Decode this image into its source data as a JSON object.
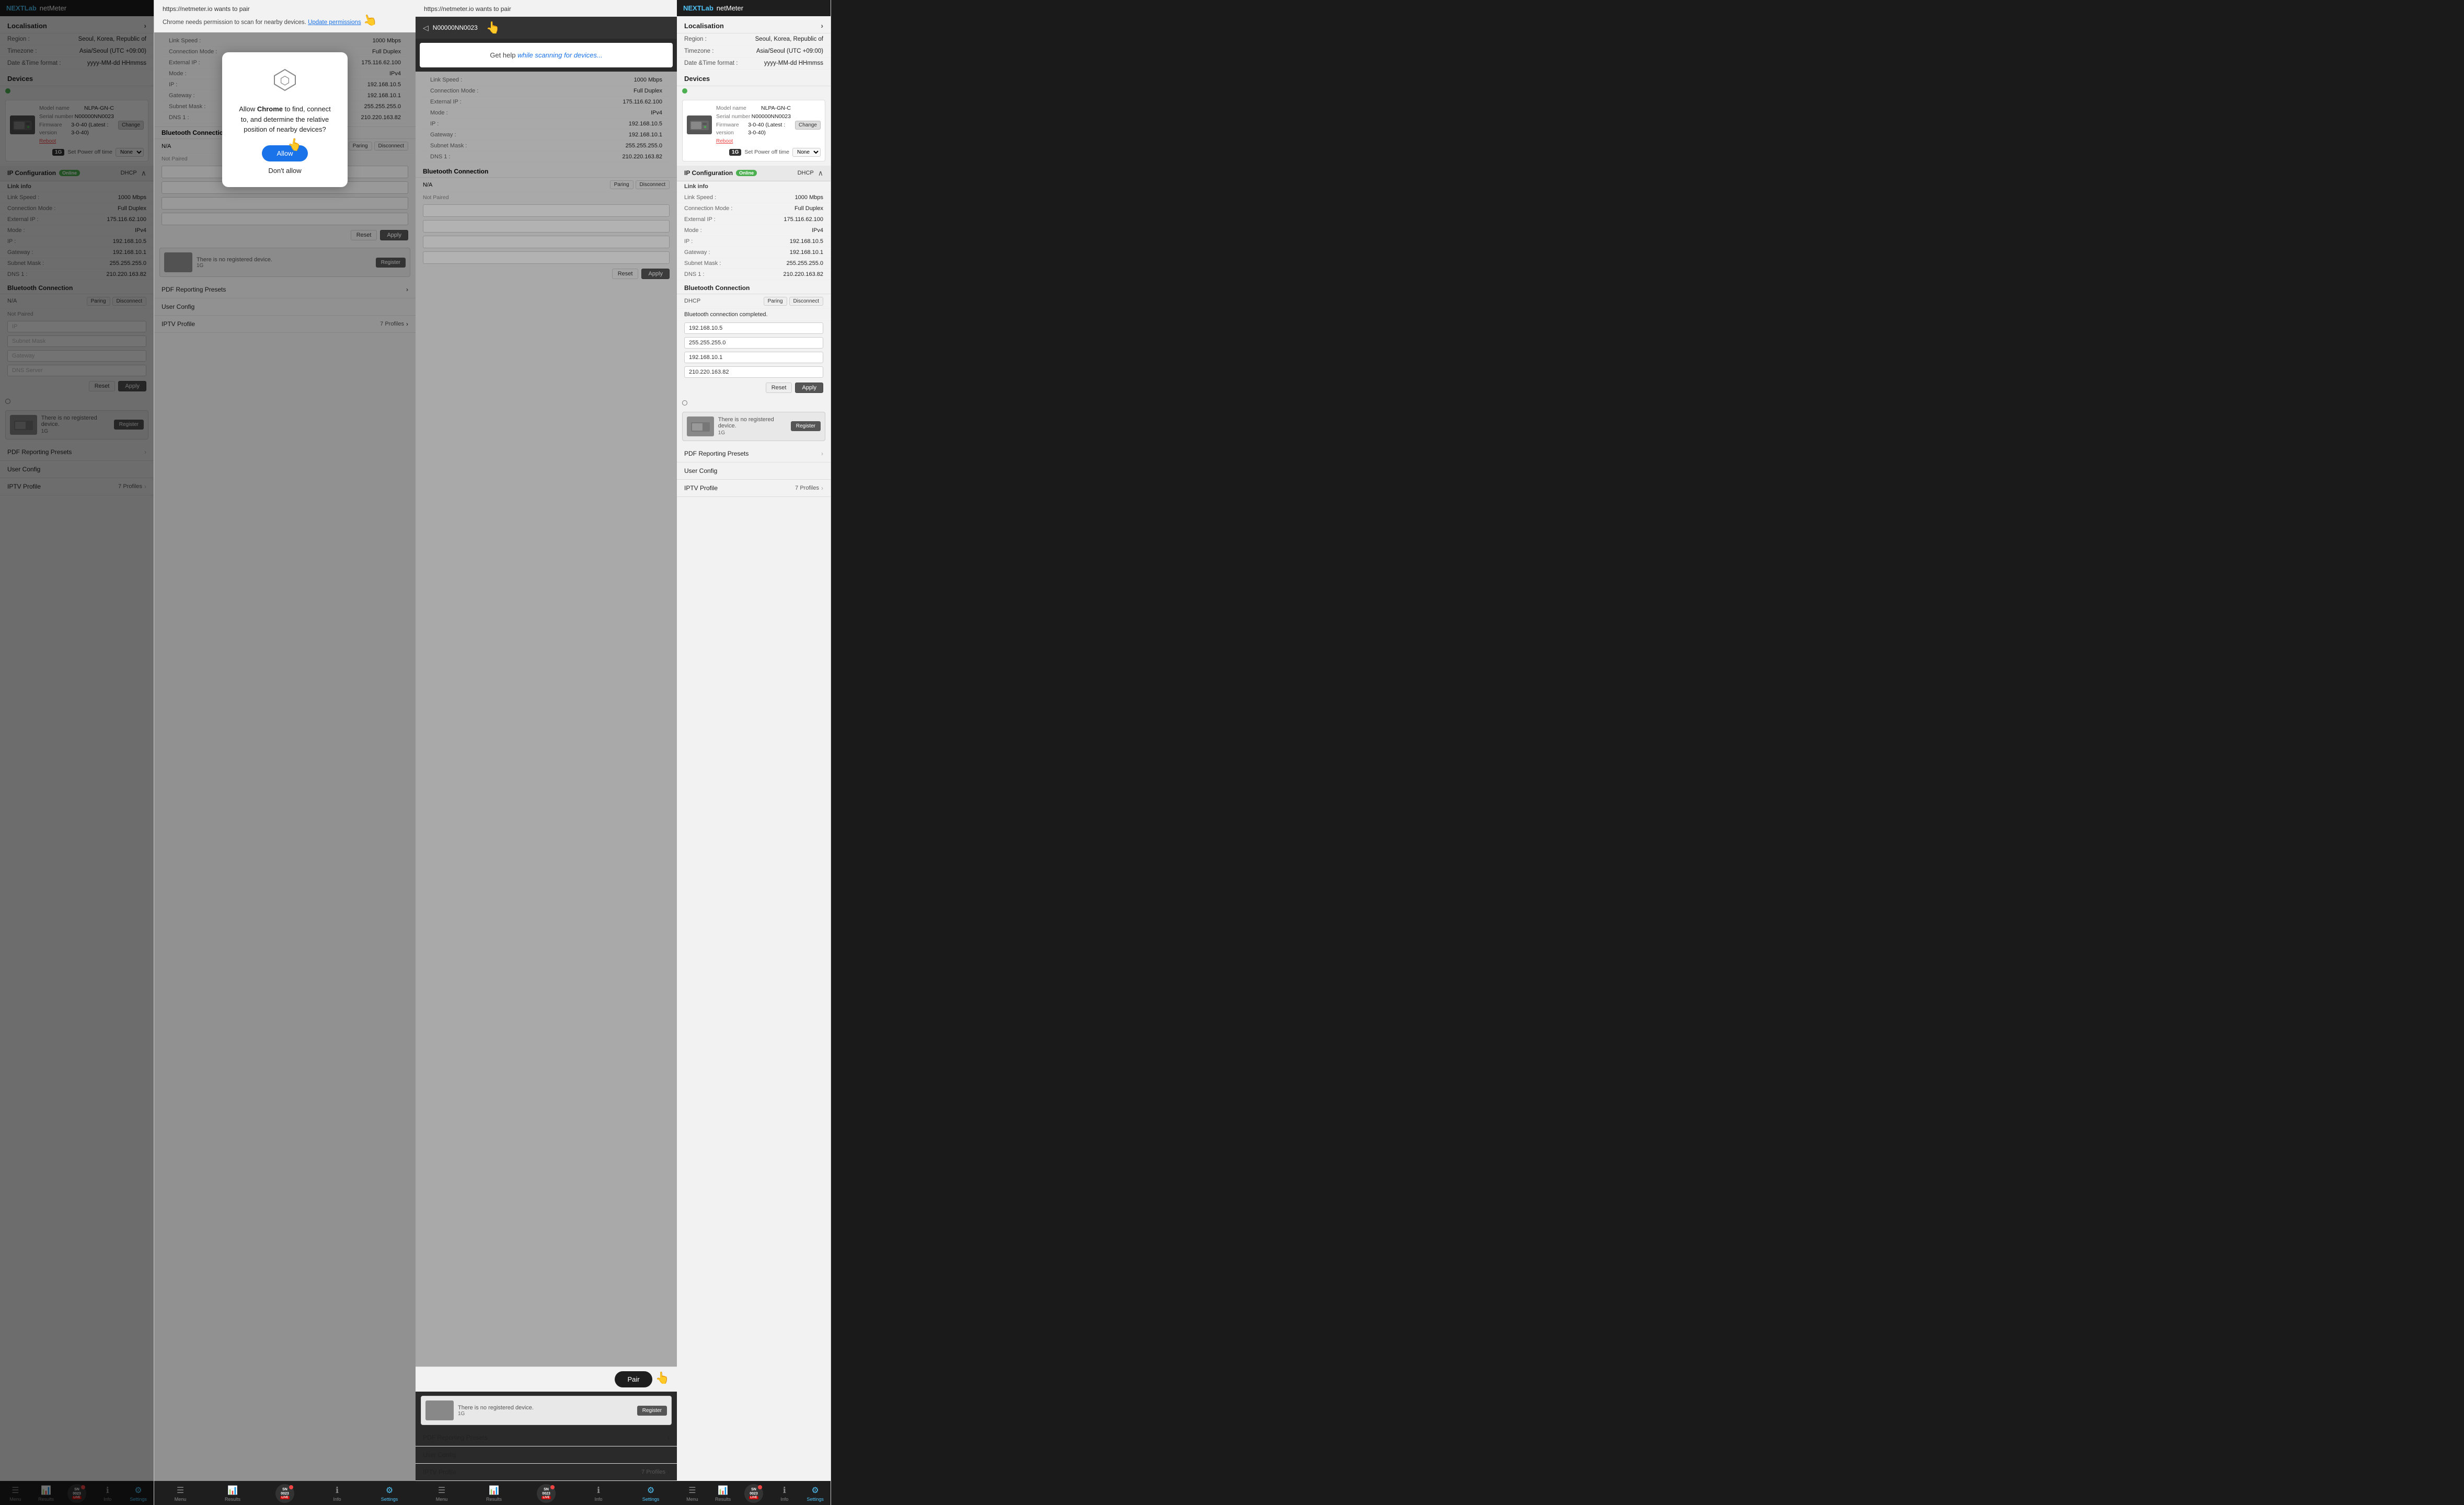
{
  "app": {
    "brand": "NEXTLab",
    "name": "netMeter"
  },
  "localisation": {
    "section_title": "Localisation",
    "region_label": "Region :",
    "region_value": "Seoul, Korea, Republic of",
    "timezone_label": "Timezone :",
    "timezone_value": "Asia/Seoul (UTC +09:00)",
    "datetime_label": "Date &Time format :",
    "datetime_value": "yyyy-MM-dd HHmmss"
  },
  "devices": {
    "section_title": "Devices",
    "device1": {
      "model_label": "Model name",
      "model_value": "NLPA-GN-C",
      "serial_label": "Serial number",
      "serial_value": "N00000NN0023",
      "firmware_label": "Firmware version",
      "firmware_value": "3-0-40 (Latest : 3-0-40)",
      "reboot_label": "Reboot",
      "power_off_label": "Set Power off time",
      "power_off_value": "None",
      "speed": "1G",
      "change_btn": "Change"
    },
    "device2": {
      "no_device_text": "There is no registered device.",
      "speed": "1G",
      "register_btn": "Register"
    }
  },
  "ip_config": {
    "section_title": "IP Configuration",
    "status_badge": "Online",
    "mode_label": "DHCP",
    "link_info_title": "Link info",
    "link_speed_label": "Link Speed :",
    "link_speed_value": "1000 Mbps",
    "conn_mode_label": "Connection Mode :",
    "conn_mode_value": "Full Duplex",
    "ext_ip_label": "External IP :",
    "ext_ip_value": "175.116.62.100",
    "mode_label2": "Mode :",
    "mode_value": "IPv4",
    "ip_label": "IP :",
    "ip_value": "192.168.10.5",
    "gateway_label": "Gateway :",
    "gateway_value": "192.168.10.1",
    "subnet_label": "Subnet Mask :",
    "subnet_value": "255.255.255.0",
    "dns_label": "DNS 1 :",
    "dns_value": "210.220.163.82"
  },
  "bluetooth": {
    "section_title": "Bluetooth Connection",
    "status": "N/A",
    "pair_btn": "Paring",
    "disconnect_btn": "Disconnect",
    "not_paired": "Not Paired",
    "ip_placeholder": "IP",
    "subnet_placeholder": "Subnet Mask",
    "gateway_placeholder": "Gateway",
    "dns_placeholder": "DNS Server",
    "reset_btn": "Reset",
    "apply_btn": "Apply",
    "completed_text": "Bluetooth connection completed.",
    "ip_value": "192.168.10.5",
    "subnet_value": "255.255.255.0",
    "gateway_value": "192.168.10.1",
    "dns_value": "210.220.163.82"
  },
  "pdf_presets": {
    "label": "PDF Reporting Presets"
  },
  "user_config": {
    "label": "User Config"
  },
  "iptv_profile": {
    "label": "IPTV Profile",
    "profiles_count": "7 Profiles"
  },
  "bottom_nav": {
    "menu": "Menu",
    "results": "Results",
    "sn": "SN 0023",
    "info": "Info",
    "settings": "Settings"
  },
  "chrome_popup": {
    "url": "https://netmeter.io wants to pair",
    "permission_msg": "Chrome needs permission to scan for nearby devices.",
    "update_link": "Update permissions",
    "device_name": "N00000NN0023",
    "get_help": "Get help",
    "scanning_msg": "Get help while scanning for devices...",
    "pair_btn": "Pair"
  },
  "bt_dialog": {
    "icon": "⬡",
    "message_pre": "Allow ",
    "message_brand": "Chrome",
    "message_post": " to find, connect to, and determine the relative position of nearby devices?",
    "allow_btn": "Allow",
    "deny_btn": "Don't allow"
  }
}
